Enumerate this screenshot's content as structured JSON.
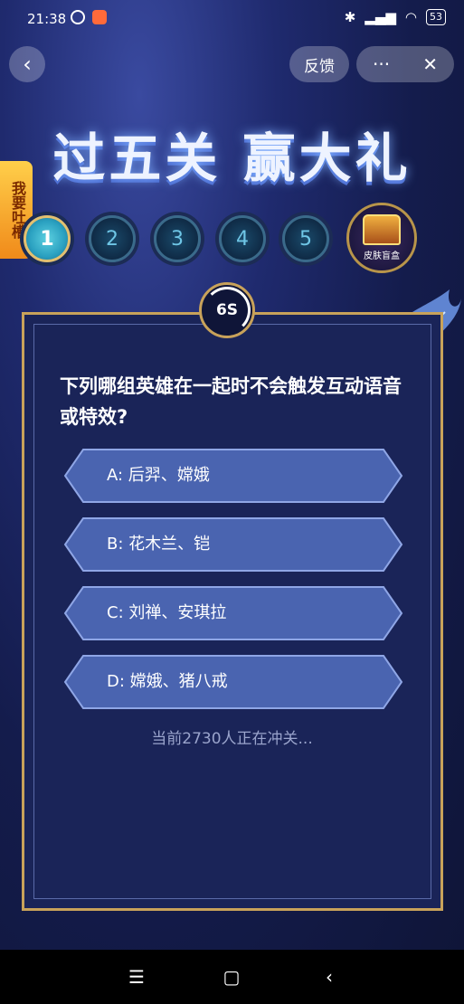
{
  "status_bar": {
    "time": "21:38",
    "battery": "53"
  },
  "header": {
    "feedback_label": "反馈",
    "more_label": "···",
    "close_label": "✕",
    "back_label": "‹"
  },
  "banner": {
    "title": "过五关 赢大礼"
  },
  "side_tab": {
    "label": "我要吐槽"
  },
  "levels": [
    {
      "label": "1",
      "active": true
    },
    {
      "label": "2",
      "active": false
    },
    {
      "label": "3",
      "active": false
    },
    {
      "label": "4",
      "active": false
    },
    {
      "label": "5",
      "active": false
    }
  ],
  "reward": {
    "label": "皮肤盲盒"
  },
  "timer": {
    "value": "6S"
  },
  "question": {
    "text": "下列哪组英雄在一起时不会触发互动语音或特效?"
  },
  "options": [
    {
      "key": "A:",
      "text": "后羿、嫦娥"
    },
    {
      "key": "B:",
      "text": "花木兰、铠"
    },
    {
      "key": "C:",
      "text": "刘禅、安琪拉"
    },
    {
      "key": "D:",
      "text": "嫦娥、猪八戒"
    }
  ],
  "online_status": "当前2730人正在冲关...",
  "colors": {
    "accent_gold": "#c8a25a",
    "option_fill": "#4a64b0",
    "card_bg": "#1a2458"
  }
}
